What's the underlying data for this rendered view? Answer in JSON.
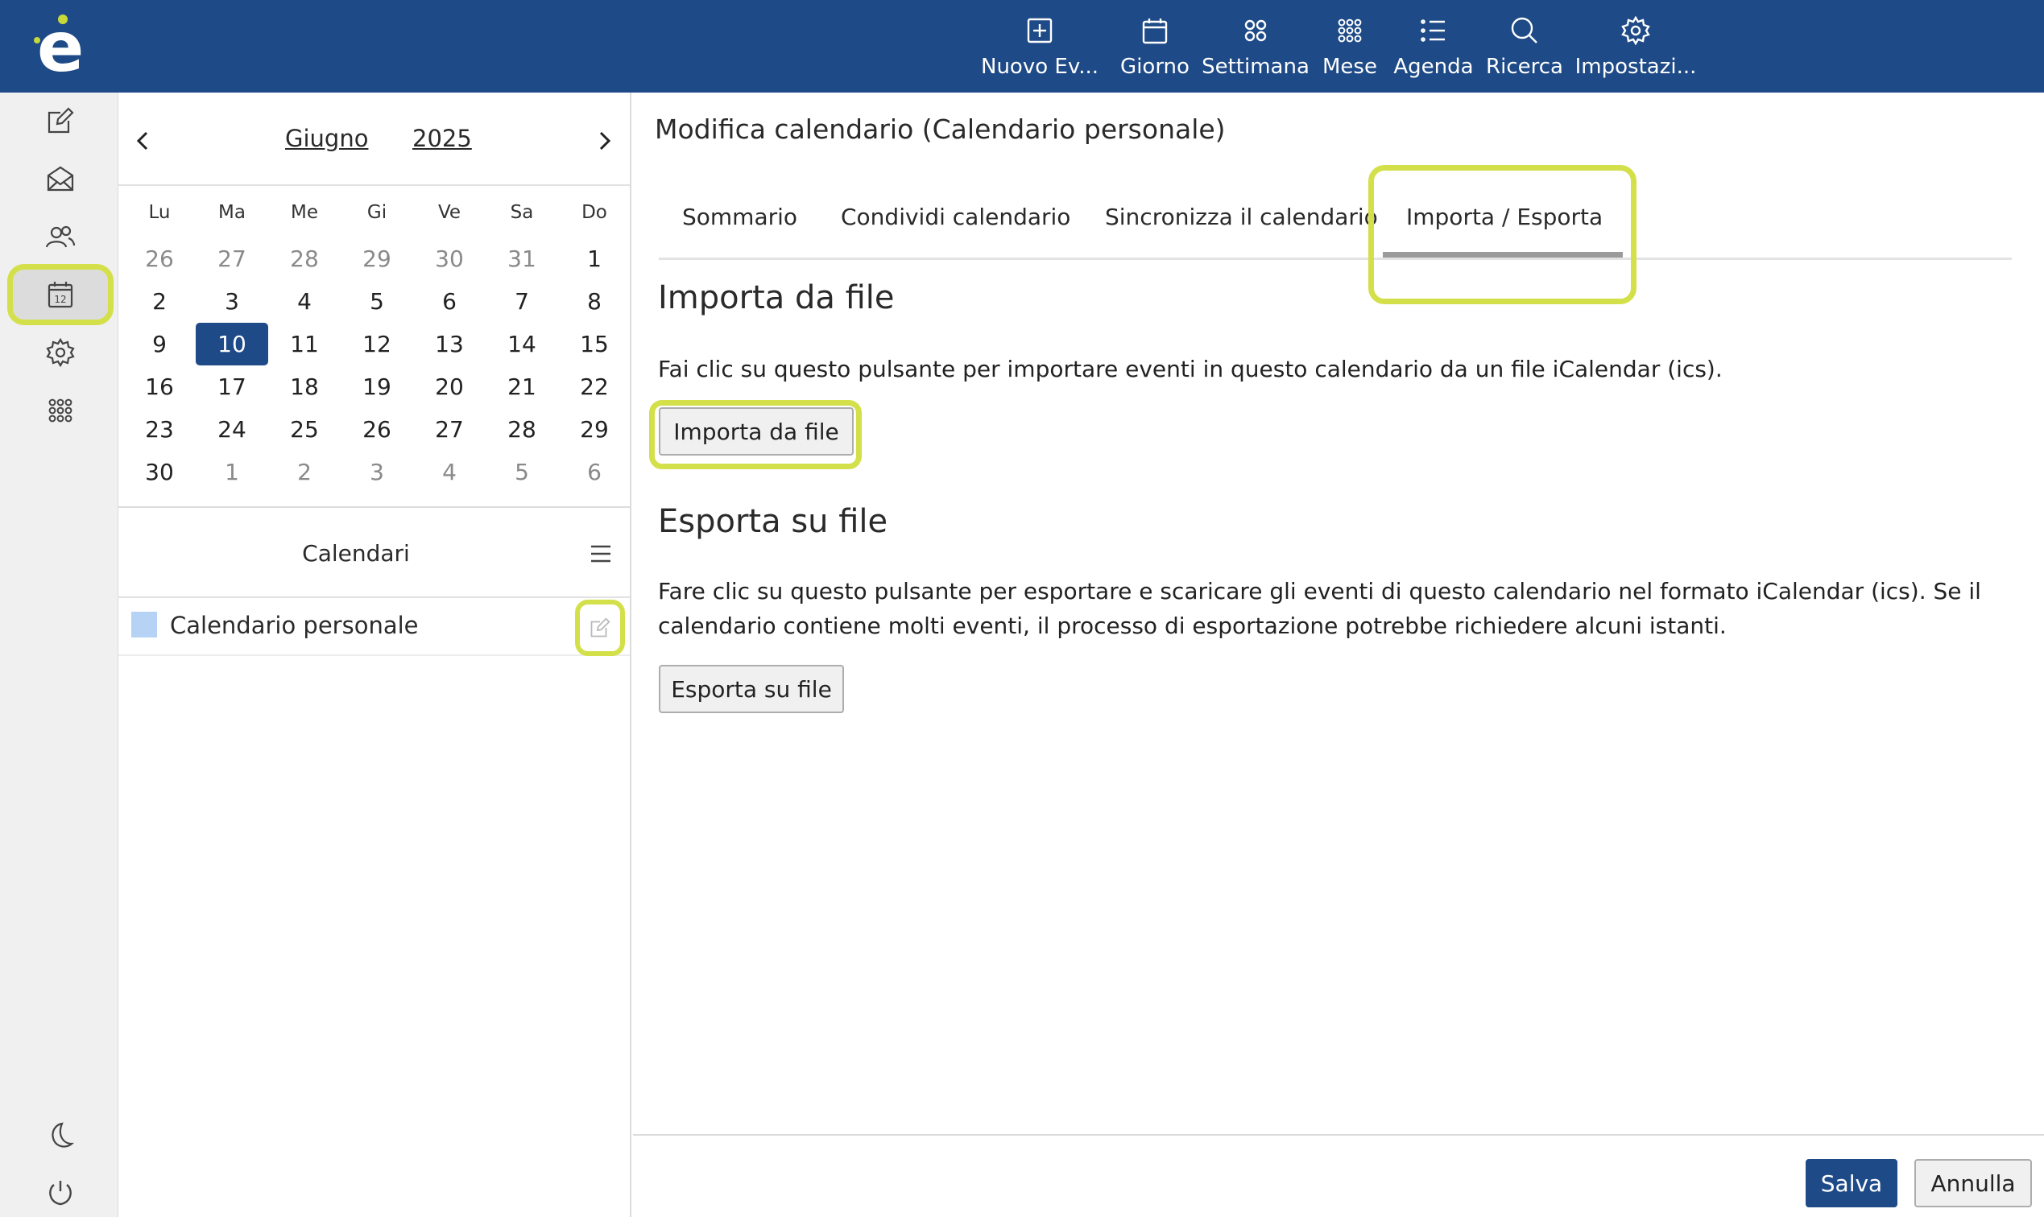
{
  "app": {
    "logo_letter": "e",
    "accent_color": "#1e4a87",
    "highlight_color": "#d3e04a"
  },
  "toolbar": {
    "items": [
      {
        "label": "Nuovo Ev...",
        "icon": "plus-square-icon"
      },
      {
        "label": "Giorno",
        "icon": "calendar-day-icon"
      },
      {
        "label": "Settimana",
        "icon": "four-dots-icon"
      },
      {
        "label": "Mese",
        "icon": "nine-dots-icon"
      },
      {
        "label": "Agenda",
        "icon": "list-icon"
      },
      {
        "label": "Ricerca",
        "icon": "search-icon"
      },
      {
        "label": "Impostazi...",
        "icon": "gear-icon"
      }
    ]
  },
  "rail": {
    "items": [
      "compose-icon",
      "mail-icon",
      "contacts-icon",
      "calendar-icon",
      "settings-icon",
      "apps-grid-icon",
      "dark-mode-icon",
      "logout-icon"
    ],
    "active": "calendar-icon",
    "calendar_icon_number": "12"
  },
  "datepicker": {
    "month": "Giugno",
    "year": "2025",
    "weekdays": [
      "Lu",
      "Ma",
      "Me",
      "Gi",
      "Ve",
      "Sa",
      "Do"
    ],
    "weeks": [
      [
        [
          "26",
          true
        ],
        [
          "27",
          true
        ],
        [
          "28",
          true
        ],
        [
          "29",
          true
        ],
        [
          "30",
          true
        ],
        [
          "31",
          true
        ],
        [
          "1",
          false
        ]
      ],
      [
        [
          "2",
          false
        ],
        [
          "3",
          false
        ],
        [
          "4",
          false
        ],
        [
          "5",
          false
        ],
        [
          "6",
          false
        ],
        [
          "7",
          false
        ],
        [
          "8",
          false
        ]
      ],
      [
        [
          "9",
          false
        ],
        [
          "10",
          false
        ],
        [
          "11",
          false
        ],
        [
          "12",
          false
        ],
        [
          "13",
          false
        ],
        [
          "14",
          false
        ],
        [
          "15",
          false
        ]
      ],
      [
        [
          "16",
          false
        ],
        [
          "17",
          false
        ],
        [
          "18",
          false
        ],
        [
          "19",
          false
        ],
        [
          "20",
          false
        ],
        [
          "21",
          false
        ],
        [
          "22",
          false
        ]
      ],
      [
        [
          "23",
          false
        ],
        [
          "24",
          false
        ],
        [
          "25",
          false
        ],
        [
          "26",
          false
        ],
        [
          "27",
          false
        ],
        [
          "28",
          false
        ],
        [
          "29",
          false
        ]
      ],
      [
        [
          "30",
          false
        ],
        [
          "1",
          true
        ],
        [
          "2",
          true
        ],
        [
          "3",
          true
        ],
        [
          "4",
          true
        ],
        [
          "5",
          true
        ],
        [
          "6",
          true
        ]
      ]
    ],
    "selected": "10"
  },
  "calendars": {
    "title": "Calendari",
    "items": [
      {
        "name": "Calendario personale",
        "color": "#b6d3f5"
      }
    ]
  },
  "main": {
    "title": "Modifica calendario (Calendario personale)",
    "tabs": [
      "Sommario",
      "Condividi calendario",
      "Sincronizza il calendario",
      "Importa / Esporta"
    ],
    "active_tab": "Importa / Esporta",
    "import": {
      "heading": "Importa da file",
      "text": "Fai clic su questo pulsante per importare eventi in questo calendario da un file iCalendar (ics).",
      "button": "Importa da file"
    },
    "export": {
      "heading": "Esporta su file",
      "text": "Fare clic su questo pulsante per esportare e scaricare gli eventi di questo calendario nel formato iCalendar (ics). Se il calendario contiene molti eventi, il processo di esportazione potrebbe richiedere alcuni istanti.",
      "button": "Esporta su file"
    },
    "save_label": "Salva",
    "cancel_label": "Annulla"
  }
}
